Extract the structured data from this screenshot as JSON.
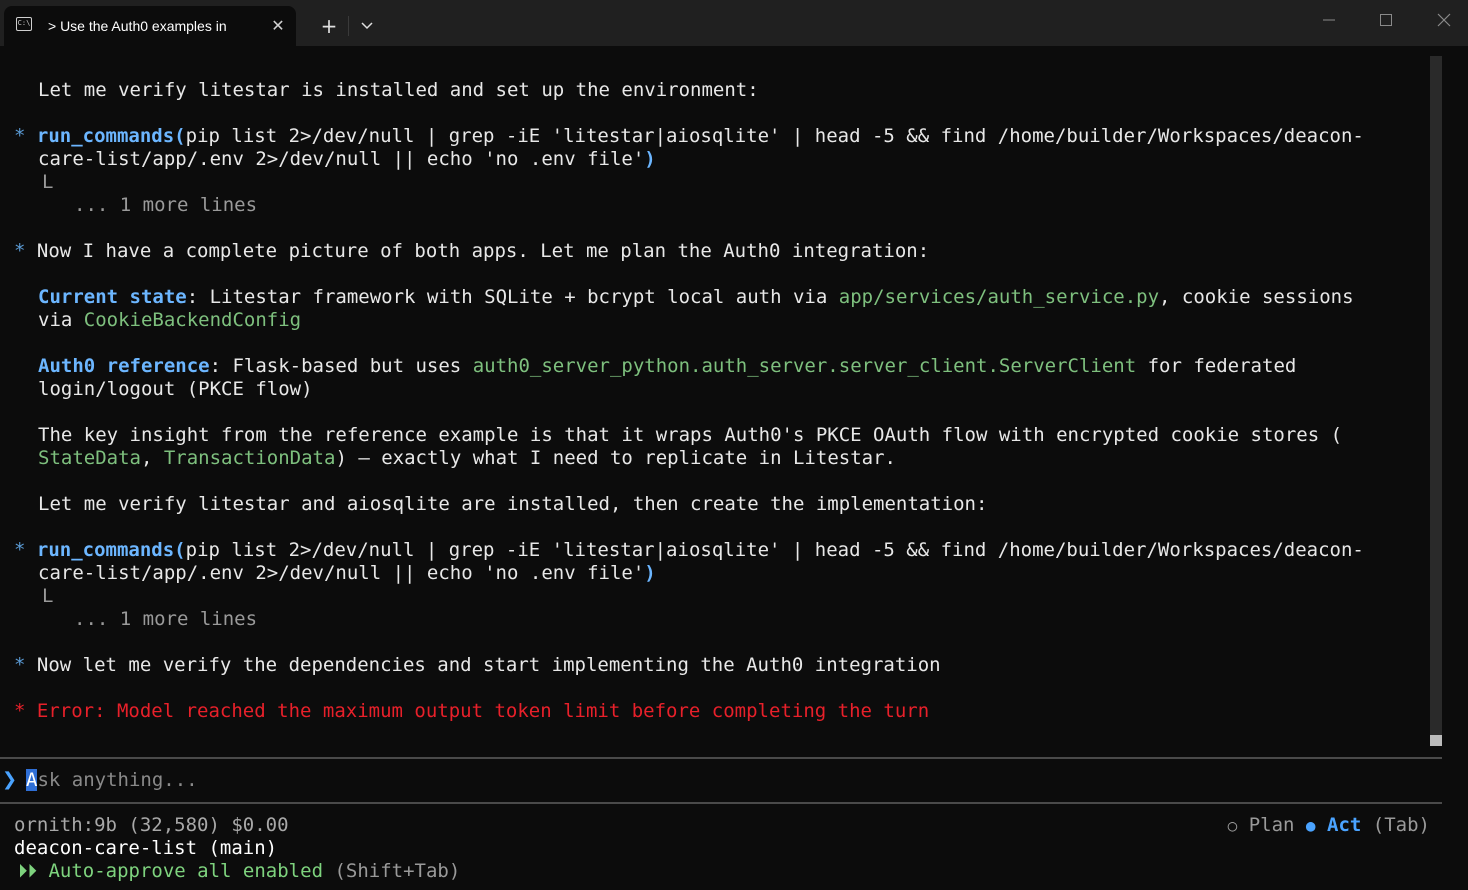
{
  "window": {
    "tab_title": "> Use the Auth0 examples in ",
    "tab_icon_glyph": "C:\\",
    "close_glyph": "✕",
    "new_tab_glyph": "+"
  },
  "transcript": {
    "l1": "Let me verify litestar is installed and set up the environment:",
    "l2_star": "*",
    "l2_cmd": "run_commands(",
    "l2_rest": "pip list 2>/dev/null | grep -iE 'litestar|aiosqlite' | head -5 && find /home/builder/Workspaces/deacon-",
    "l3_text": "care-list/app/.env 2>/dev/null || echo 'no .env file'",
    "l3_paren": ")",
    "l4": "L",
    "l5": "... 1 more lines",
    "l6_star": "*",
    "l6_text": "Now I have a complete picture of both apps. Let me plan the Auth0 integration:",
    "l7_label": "Current state",
    "l7_a": ": Litestar framework with SQLite + bcrypt local auth via ",
    "l7_path": "app/services/auth_service.py",
    "l7_b": ", cookie sessions",
    "l8_a": "via ",
    "l8_code": "CookieBackendConfig",
    "l9_label": "Auth0 reference",
    "l9_a": ": Flask-based but uses ",
    "l9_code": "auth0_server_python.auth_server.server_client.ServerClient",
    "l9_b": " for federated",
    "l10": "login/logout (PKCE flow)",
    "l11": "The key insight from the reference example is that it wraps Auth0's PKCE OAuth flow with encrypted cookie stores (",
    "l12_code1": "StateData",
    "l12_sep": ", ",
    "l12_code2": "TransactionData",
    "l12_rest": ") — exactly what I need to replicate in Litestar.",
    "l13": "Let me verify litestar and aiosqlite are installed, then create the implementation:",
    "l14_star": "*",
    "l14_cmd": "run_commands(",
    "l14_rest": "pip list 2>/dev/null | grep -iE 'litestar|aiosqlite' | head -5 && find /home/builder/Workspaces/deacon-",
    "l15_text": "care-list/app/.env 2>/dev/null || echo 'no .env file'",
    "l15_paren": ")",
    "l16": "L",
    "l17": "... 1 more lines",
    "l18_star": "*",
    "l18_text": "Now let me verify the dependencies and start implementing the Auth0 integration",
    "l19_star": "*",
    "l19_text": "Error: Model reached the maximum output token limit before completing the turn"
  },
  "prompt": {
    "arrow": "❯",
    "cursor_char": "A",
    "placeholder_rest": "sk anything..."
  },
  "status": {
    "model": "ornith:9b (32,580) $0.00",
    "project": "deacon-care-list (main)",
    "auto_icon": "⏵⏵",
    "auto_text": "Auto-approve all enabled",
    "auto_hint": " (Shift+Tab)",
    "plan_glyph": "○",
    "plan_label": "Plan",
    "act_glyph": "●",
    "act_label": "Act",
    "mode_hint": "(Tab)"
  },
  "colors": {
    "background": "#0c0c0c",
    "accent_blue": "#6cb6ff",
    "code_green": "#7ec07e",
    "error_red": "#e8202a"
  }
}
